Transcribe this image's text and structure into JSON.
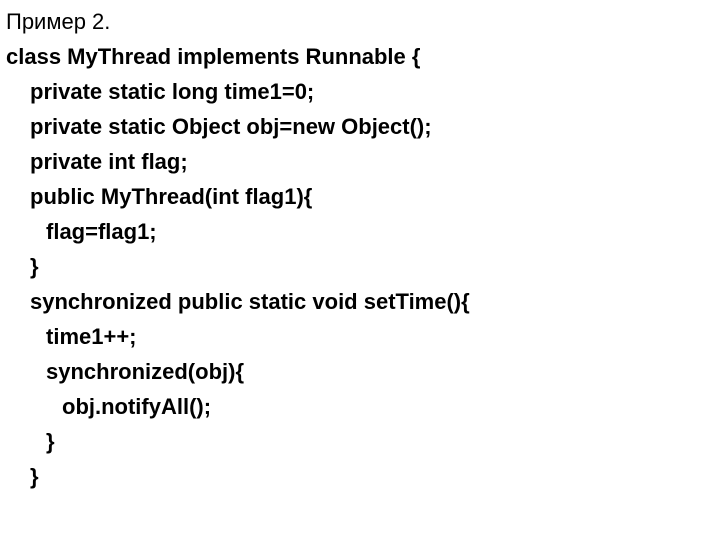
{
  "title": "Пример 2.",
  "code": {
    "l01": "class MyThread implements Runnable {",
    "l02": "private static long time1=0;",
    "l03": "private static Object obj=new Object();",
    "l04": "private int flag;",
    "l05": "public MyThread(int flag1){",
    "l06": "flag=flag1;",
    "l07": "}",
    "l08": "synchronized public static void setTime(){",
    "l09": "time1++;",
    "l10": "synchronized(obj){",
    "l11": "obj.notifyAll();",
    "l12": "}",
    "l13": "}"
  }
}
